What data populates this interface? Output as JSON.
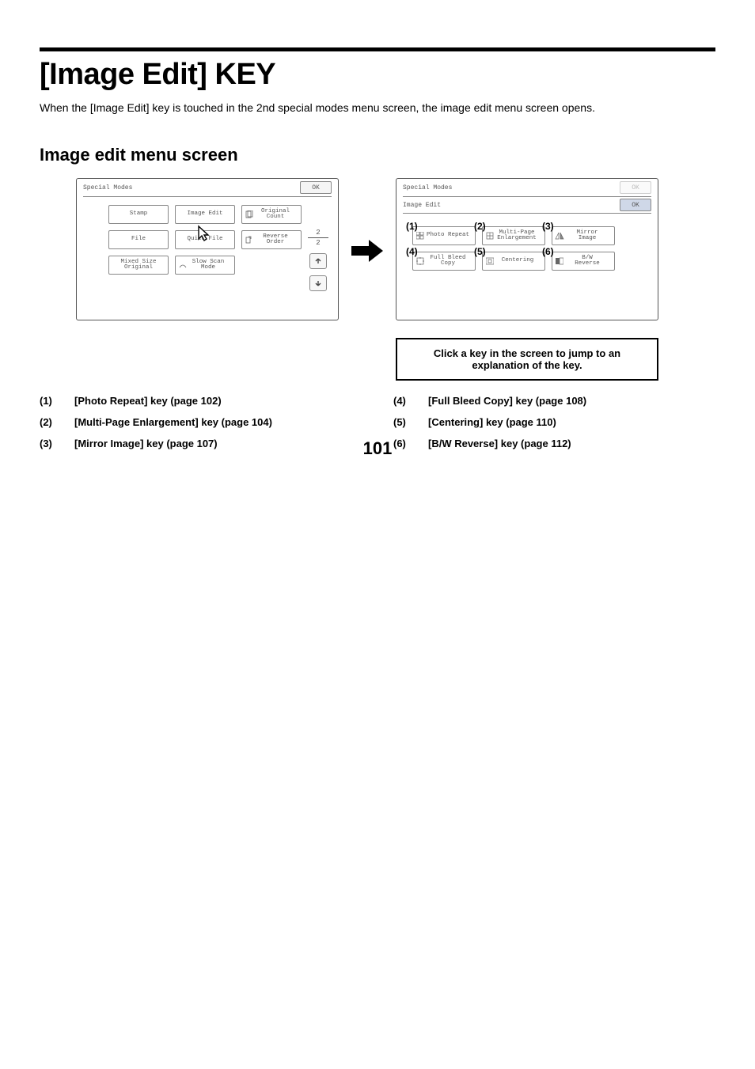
{
  "rule": "",
  "title": "[Image Edit] KEY",
  "intro": "When the [Image Edit] key is touched in the 2nd special modes menu screen, the image edit menu screen opens.",
  "subheading": "Image edit menu screen",
  "panel_left": {
    "header": "Special Modes",
    "ok": "OK",
    "tiles": [
      {
        "label": "Stamp"
      },
      {
        "label": "Image Edit"
      },
      {
        "label": "Original\nCount"
      },
      {
        "label": "File"
      },
      {
        "label": "Quick File"
      },
      {
        "label": "Reverse\nOrder"
      },
      {
        "label": "Mixed Size\nOriginal"
      },
      {
        "label": "Slow Scan\nMode"
      }
    ],
    "pager": {
      "top": "2",
      "bottom": "2"
    }
  },
  "panel_right": {
    "header": "Special Modes",
    "ok": "OK",
    "sub_header": "Image Edit",
    "sub_ok": "OK",
    "tiles": [
      {
        "num": "(1)",
        "label": "Photo Repeat"
      },
      {
        "num": "(2)",
        "label": "Multi-Page\nEnlargement"
      },
      {
        "num": "(3)",
        "label": "Mirror\nImage"
      },
      {
        "num": "(4)",
        "label": "Full Bleed\nCopy"
      },
      {
        "num": "(5)",
        "label": "Centering"
      },
      {
        "num": "(6)",
        "label": "B/W\nReverse"
      }
    ]
  },
  "note": "Click a key in the screen to jump to an explanation of the key.",
  "list_left": [
    {
      "n": "(1)",
      "t": "[Photo Repeat] key (page 102)"
    },
    {
      "n": "(2)",
      "t": "[Multi-Page Enlargement] key (page 104)"
    },
    {
      "n": "(3)",
      "t": "[Mirror Image] key (page 107)"
    }
  ],
  "list_right": [
    {
      "n": "(4)",
      "t": "[Full Bleed Copy] key (page 108)"
    },
    {
      "n": "(5)",
      "t": "[Centering] key  (page 110)"
    },
    {
      "n": "(6)",
      "t": "[B/W Reverse] key  (page 112)"
    }
  ],
  "page_number": "101"
}
